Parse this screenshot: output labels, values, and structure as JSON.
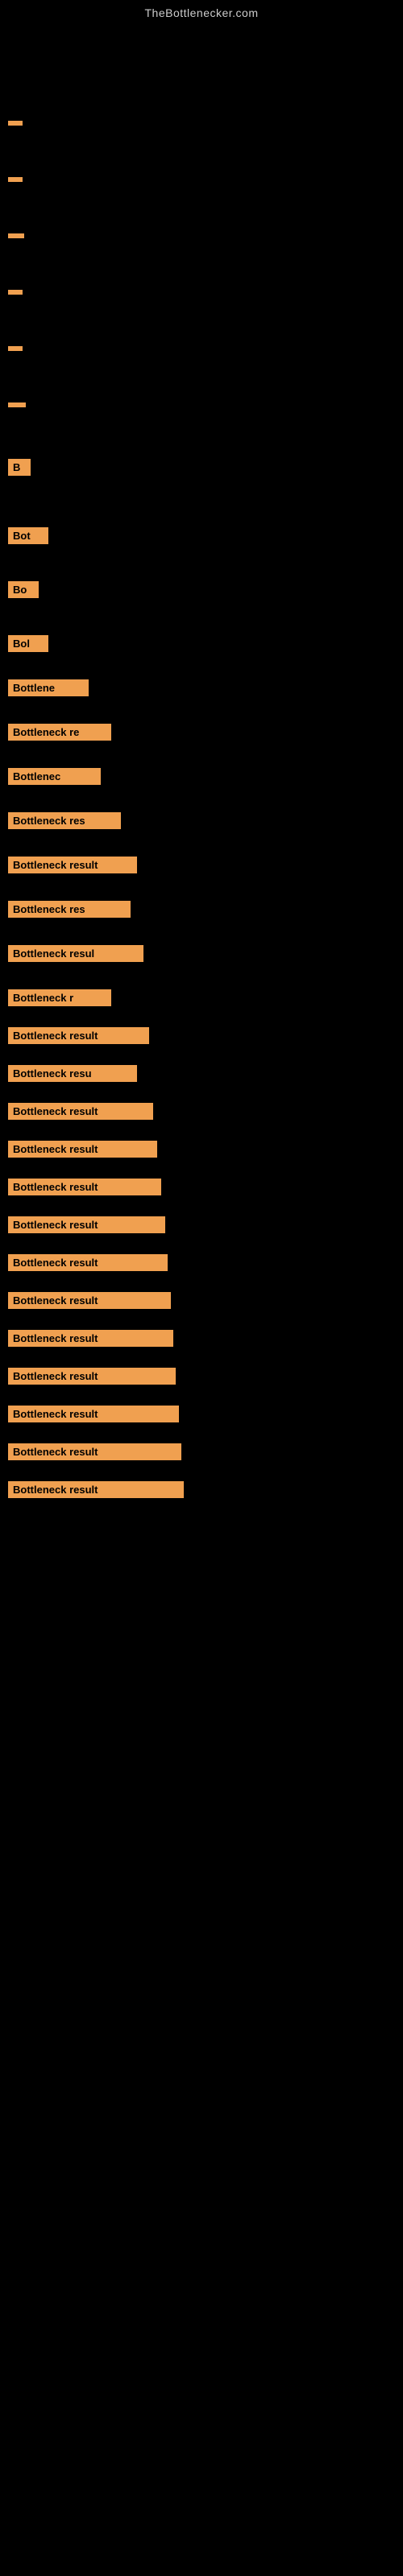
{
  "site": {
    "title": "TheBottlenecker.com"
  },
  "items": [
    {
      "id": 1,
      "label": "",
      "width_class": "w1",
      "gap_before": "xxxl"
    },
    {
      "id": 2,
      "label": "",
      "width_class": "w1",
      "gap_before": "xl"
    },
    {
      "id": 3,
      "label": "",
      "width_class": "w2",
      "gap_before": "xl"
    },
    {
      "id": 4,
      "label": "",
      "width_class": "w1",
      "gap_before": "xl"
    },
    {
      "id": 5,
      "label": "",
      "width_class": "w1",
      "gap_before": "xl"
    },
    {
      "id": 6,
      "label": "",
      "width_class": "w3",
      "gap_before": "xl"
    },
    {
      "id": 7,
      "label": "B",
      "width_class": "w5",
      "gap_before": "xl"
    },
    {
      "id": 8,
      "label": "Bot",
      "width_class": "w8",
      "gap_before": "xl"
    },
    {
      "id": 9,
      "label": "Bo",
      "width_class": "w7",
      "gap_before": "lg"
    },
    {
      "id": 10,
      "label": "Bol",
      "width_class": "w8",
      "gap_before": "lg"
    },
    {
      "id": 11,
      "label": "Bottlene",
      "width_class": "w12",
      "gap_before": "md"
    },
    {
      "id": 12,
      "label": "Bottleneck re",
      "width_class": "w14",
      "gap_before": "md"
    },
    {
      "id": 13,
      "label": "Bottlenec",
      "width_class": "w13",
      "gap_before": "md"
    },
    {
      "id": 14,
      "label": "Bottleneck res",
      "width_class": "w15",
      "gap_before": "md"
    },
    {
      "id": 15,
      "label": "Bottleneck result",
      "width_class": "w17",
      "gap_before": "md"
    },
    {
      "id": 16,
      "label": "Bottleneck res",
      "width_class": "w16",
      "gap_before": "md"
    },
    {
      "id": 17,
      "label": "Bottleneck resul",
      "width_class": "w18",
      "gap_before": "md"
    },
    {
      "id": 18,
      "label": "Bottleneck r",
      "width_class": "w14",
      "gap_before": "md"
    },
    {
      "id": 19,
      "label": "Bottleneck result",
      "width_class": "w19",
      "gap_before": "sm"
    },
    {
      "id": 20,
      "label": "Bottleneck resu",
      "width_class": "w17",
      "gap_before": "sm"
    },
    {
      "id": 21,
      "label": "Bottleneck result",
      "width_class": "w20",
      "gap_before": "sm"
    },
    {
      "id": 22,
      "label": "Bottleneck result",
      "width_class": "w21",
      "gap_before": "sm"
    },
    {
      "id": 23,
      "label": "Bottleneck result",
      "width_class": "w22",
      "gap_before": "sm"
    },
    {
      "id": 24,
      "label": "Bottleneck result",
      "width_class": "w23",
      "gap_before": "sm"
    },
    {
      "id": 25,
      "label": "Bottleneck result",
      "width_class": "w24",
      "gap_before": "sm"
    },
    {
      "id": 26,
      "label": "Bottleneck result",
      "width_class": "w25",
      "gap_before": "sm"
    },
    {
      "id": 27,
      "label": "Bottleneck result",
      "width_class": "w26",
      "gap_before": "sm"
    },
    {
      "id": 28,
      "label": "Bottleneck result",
      "width_class": "w27",
      "gap_before": "sm"
    },
    {
      "id": 29,
      "label": "Bottleneck result",
      "width_class": "w28",
      "gap_before": "sm"
    },
    {
      "id": 30,
      "label": "Bottleneck result",
      "width_class": "w29",
      "gap_before": "sm"
    },
    {
      "id": 31,
      "label": "Bottleneck result",
      "width_class": "w30",
      "gap_before": "sm"
    }
  ]
}
